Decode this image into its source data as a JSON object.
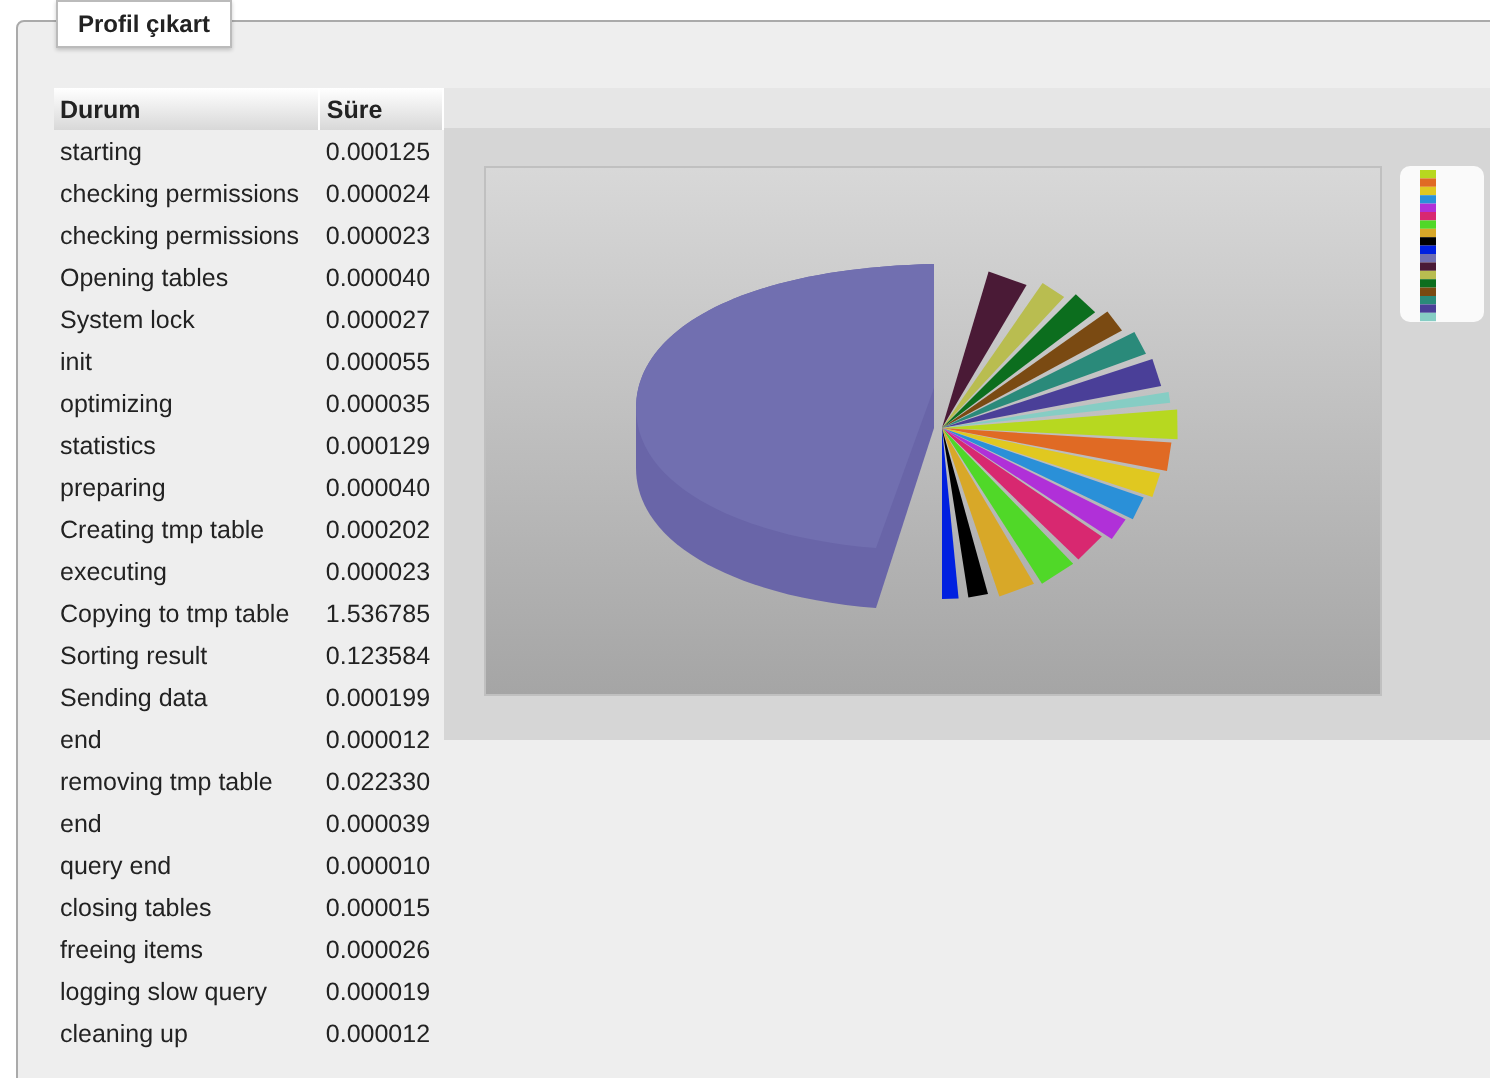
{
  "panel": {
    "title": "Profil çıkart"
  },
  "table": {
    "columns": [
      "Durum",
      "Süre"
    ],
    "rows": [
      [
        "starting",
        "0.000125"
      ],
      [
        "checking permissions",
        "0.000024"
      ],
      [
        "checking permissions",
        "0.000023"
      ],
      [
        "Opening tables",
        "0.000040"
      ],
      [
        "System lock",
        "0.000027"
      ],
      [
        "init",
        "0.000055"
      ],
      [
        "optimizing",
        "0.000035"
      ],
      [
        "statistics",
        "0.000129"
      ],
      [
        "preparing",
        "0.000040"
      ],
      [
        "Creating tmp table",
        "0.000202"
      ],
      [
        "executing",
        "0.000023"
      ],
      [
        "Copying to tmp table",
        "1.536785"
      ],
      [
        "Sorting result",
        "0.123584"
      ],
      [
        "Sending data",
        "0.000199"
      ],
      [
        "end",
        "0.000012"
      ],
      [
        "removing tmp table",
        "0.022330"
      ],
      [
        "end",
        "0.000039"
      ],
      [
        "query end",
        "0.000010"
      ],
      [
        "closing tables",
        "0.000015"
      ],
      [
        "freeing items",
        "0.000026"
      ],
      [
        "logging slow query",
        "0.000019"
      ],
      [
        "cleaning up",
        "0.000012"
      ]
    ]
  }
}
